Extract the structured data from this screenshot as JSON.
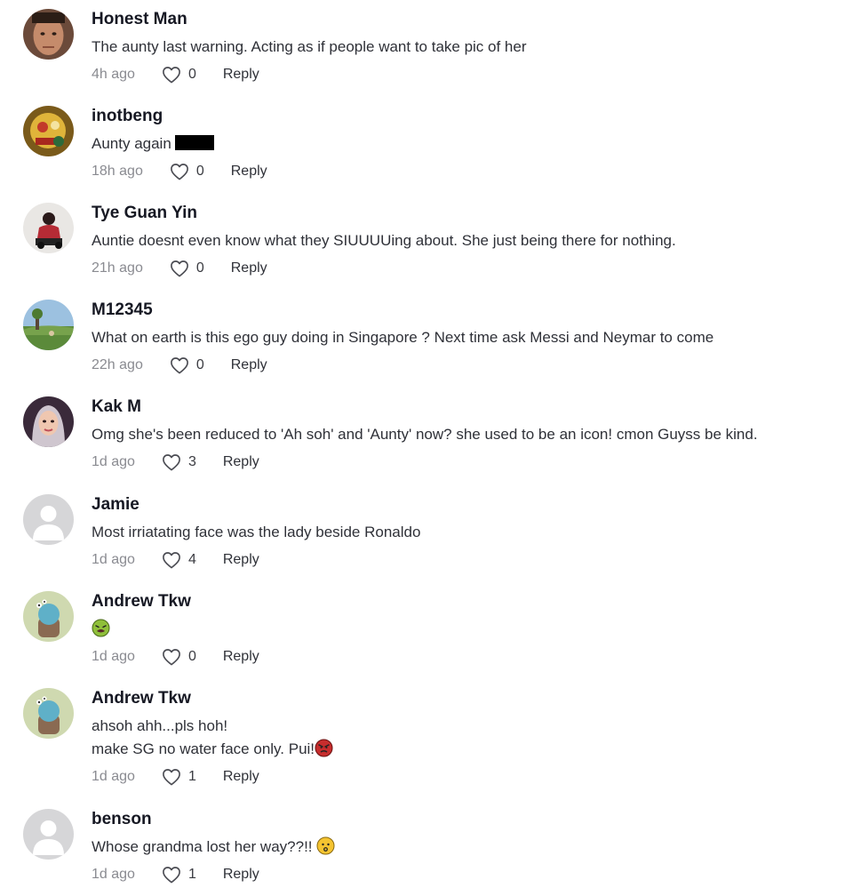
{
  "comments": [
    {
      "username": "Honest Man",
      "text": "The aunty last warning. Acting as if people want to take pic of her",
      "time": "4h ago",
      "likes": "0",
      "reply": "Reply",
      "avatar": "man-face-avatar"
    },
    {
      "username": "inotbeng",
      "text": "Aunty again",
      "time": "18h ago",
      "likes": "0",
      "reply": "Reply",
      "avatar": "lion-dance-avatar"
    },
    {
      "username": "Tye Guan Yin",
      "text": "Auntie doesnt even know what they SIUUUUing about. She just being there for nothing.",
      "time": "21h ago",
      "likes": "0",
      "reply": "Reply",
      "avatar": "person-sitting-avatar"
    },
    {
      "username": "M12345",
      "text": "What on earth is this ego guy doing in Singapore ? Next time ask Messi and Neymar to come",
      "time": "22h ago",
      "likes": "0",
      "reply": "Reply",
      "avatar": "landscape-avatar"
    },
    {
      "username": "Kak M",
      "text": "Omg she's been reduced to 'Ah soh' and 'Aunty' now? she used to be an icon! cmon Guyss be kind.",
      "time": "1d ago",
      "likes": "3",
      "reply": "Reply",
      "avatar": "woman-hijab-avatar"
    },
    {
      "username": "Jamie",
      "text": "Most irriatating face was the lady beside Ronaldo",
      "time": "1d ago",
      "likes": "4",
      "reply": "Reply",
      "avatar": "default-avatar"
    },
    {
      "username": "Andrew Tkw",
      "text": "",
      "time": "1d ago",
      "likes": "0",
      "reply": "Reply",
      "avatar": "cartoon-avatar"
    },
    {
      "username": "Andrew Tkw",
      "text_line1": "ahsoh ahh...pls hoh!",
      "text_line2": "make SG no water face only. Pui!",
      "time": "1d ago",
      "likes": "1",
      "reply": "Reply",
      "avatar": "cartoon-avatar"
    },
    {
      "username": "benson",
      "text": "Whose grandma lost her way??!!",
      "time": "1d ago",
      "likes": "1",
      "reply": "Reply",
      "avatar": "default-avatar"
    }
  ],
  "icons": {
    "like": "heart-outline-icon",
    "redaction": "black-redaction-bar",
    "emoji_nauseated": "nauseated-face-emoji",
    "emoji_angry": "angry-face-emoji",
    "emoji_confused": "confused-face-emoji"
  },
  "colors": {
    "username": "#161823",
    "text": "#2f3138",
    "timestamp": "#8a8b91",
    "background": "#ffffff"
  }
}
